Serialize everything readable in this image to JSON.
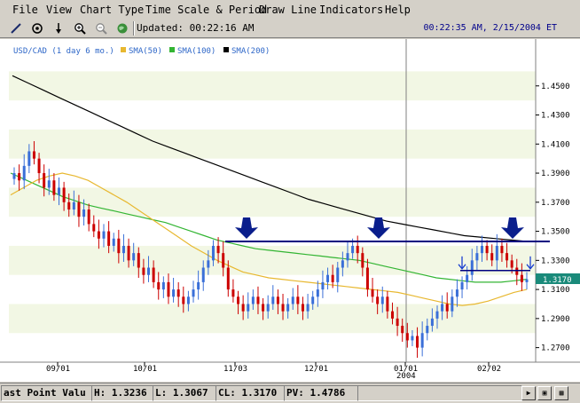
{
  "menu": {
    "items": [
      "File",
      "View",
      "Chart Type",
      "Time Scale & Period",
      "Draw Line",
      "Indicators",
      "Help"
    ]
  },
  "toolbar": {
    "tools": [
      "draw-line-icon",
      "target-icon",
      "arrow-down-icon",
      "zoom-in-icon",
      "zoom-out-icon",
      "globe-icon"
    ],
    "updated_label": "Updated: 00:22:16 AM",
    "datetime": "00:22:35 AM, 2/15/2004 ET"
  },
  "legend": {
    "symbol": "USD/CAD (1 day  6 mo.)",
    "sma50": "SMA(50)",
    "sma100": "SMA(100)",
    "sma200": "SMA(200)"
  },
  "colors": {
    "up_candle": "#3a6fd8",
    "down_candle": "#cc0000",
    "sma50": "#e8b830",
    "sma100": "#33b533",
    "sma200": "#000000",
    "resistance": "#000080",
    "arrow": "#0a1e8c",
    "price_tag": "#1a8a7a"
  },
  "chart_data": {
    "type": "candlestick",
    "symbol": "USD/CAD",
    "ylim": [
      1.26,
      1.47
    ],
    "y_ticks": [
      "1.4500",
      "1.4300",
      "1.4100",
      "1.3900",
      "1.3700",
      "1.3500",
      "1.3300",
      "1.3100",
      "1.2900",
      "1.2700"
    ],
    "x_ticks": [
      "09/01",
      "10/01",
      "11/03",
      "12/01",
      "01/01",
      "02/02"
    ],
    "x_year_label": "2004",
    "last_price": "1.3170",
    "resistance_level": 1.343,
    "secondary_level": 1.323,
    "closes": [
      1.39,
      1.385,
      1.395,
      1.405,
      1.4,
      1.39,
      1.38,
      1.385,
      1.375,
      1.38,
      1.37,
      1.365,
      1.37,
      1.36,
      1.365,
      1.355,
      1.35,
      1.345,
      1.35,
      1.34,
      1.345,
      1.335,
      1.34,
      1.33,
      1.335,
      1.325,
      1.32,
      1.325,
      1.315,
      1.31,
      1.315,
      1.305,
      1.31,
      1.305,
      1.3,
      1.305,
      1.31,
      1.315,
      1.325,
      1.33,
      1.34,
      1.335,
      1.325,
      1.31,
      1.305,
      1.3,
      1.295,
      1.3,
      1.305,
      1.3,
      1.295,
      1.3,
      1.305,
      1.3,
      1.295,
      1.3,
      1.305,
      1.3,
      1.295,
      1.3,
      1.305,
      1.31,
      1.315,
      1.32,
      1.315,
      1.325,
      1.33,
      1.335,
      1.34,
      1.335,
      1.325,
      1.31,
      1.305,
      1.3,
      1.305,
      1.295,
      1.29,
      1.285,
      1.28,
      1.275,
      1.278,
      1.27,
      1.28,
      1.285,
      1.29,
      1.295,
      1.3,
      1.295,
      1.305,
      1.31,
      1.315,
      1.32,
      1.33,
      1.335,
      1.34,
      1.335,
      1.33,
      1.34,
      1.335,
      1.33,
      1.325,
      1.32,
      1.315,
      1.317
    ],
    "sma50": [
      1.375,
      1.38,
      1.385,
      1.388,
      1.39,
      1.388,
      1.385,
      1.38,
      1.375,
      1.37,
      1.364,
      1.358,
      1.352,
      1.346,
      1.34,
      1.335,
      1.33,
      1.326,
      1.322,
      1.32,
      1.318,
      1.317,
      1.316,
      1.315,
      1.314,
      1.313,
      1.312,
      1.311,
      1.31,
      1.309,
      1.308,
      1.306,
      1.304,
      1.302,
      1.3,
      1.299,
      1.3,
      1.302,
      1.305,
      1.308,
      1.31
    ],
    "sma100": [
      1.39,
      1.386,
      1.382,
      1.378,
      1.374,
      1.371,
      1.368,
      1.366,
      1.364,
      1.362,
      1.36,
      1.358,
      1.356,
      1.353,
      1.35,
      1.347,
      1.344,
      1.342,
      1.34,
      1.338,
      1.337,
      1.336,
      1.335,
      1.334,
      1.333,
      1.332,
      1.331,
      1.33,
      1.328,
      1.326,
      1.324,
      1.322,
      1.32,
      1.318,
      1.317,
      1.316,
      1.315,
      1.315,
      1.315,
      1.316,
      1.317
    ],
    "sma200": [
      1.457,
      1.452,
      1.447,
      1.442,
      1.437,
      1.432,
      1.427,
      1.422,
      1.417,
      1.412,
      1.408,
      1.404,
      1.4,
      1.396,
      1.392,
      1.388,
      1.384,
      1.38,
      1.376,
      1.372,
      1.369,
      1.366,
      1.363,
      1.36,
      1.357,
      1.355,
      1.353,
      1.351,
      1.349,
      1.347,
      1.346,
      1.345,
      1.344,
      1.343
    ],
    "sma200_end_index": 33
  },
  "status": {
    "last_point_label": "ast Point Valu",
    "h_label": "H:",
    "h_value": "1.3236",
    "l_label": "L:",
    "l_value": "1.3067",
    "cl_label": "CL:",
    "cl_value": "1.3170",
    "pv_label": "PV:",
    "pv_value": "1.4786"
  }
}
